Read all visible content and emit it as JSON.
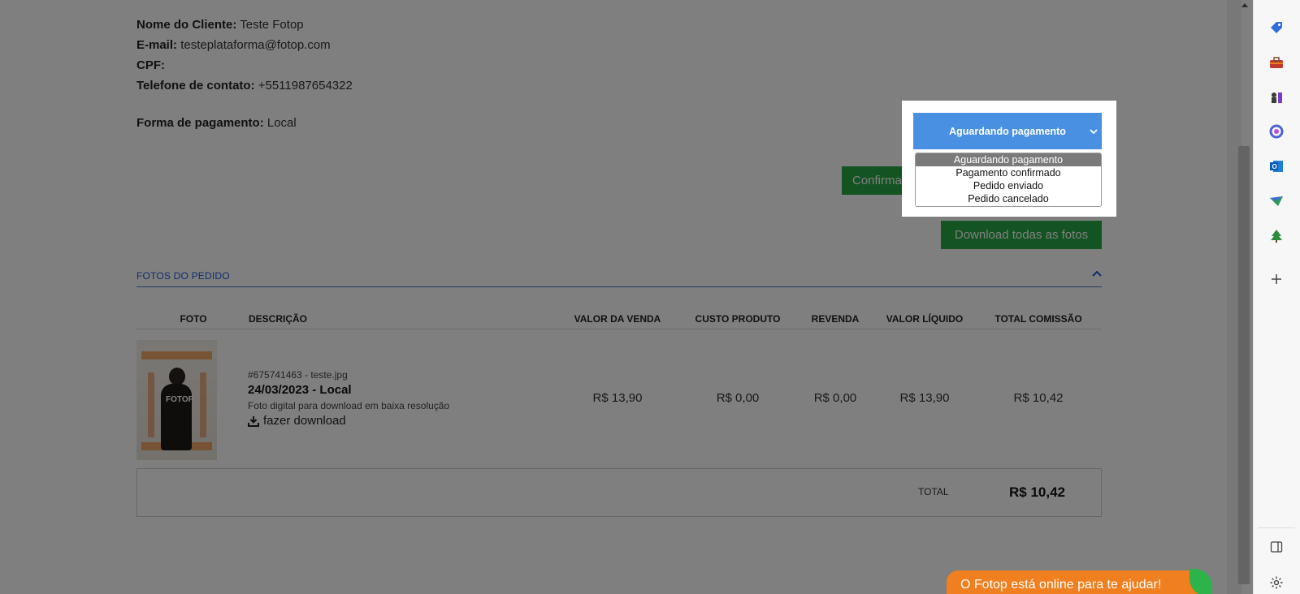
{
  "customer": {
    "name_label": "Nome do Cliente:",
    "name_value": "Teste Fotop",
    "email_label": "E-mail:",
    "email_value": "testeplataforma@fotop.com",
    "cpf_label": "CPF:",
    "cpf_value": "",
    "phone_label": "Telefone de contato:",
    "phone_value": "+5511987654322",
    "payment_label": "Forma de pagamento:",
    "payment_value": "Local"
  },
  "actions": {
    "confirm_label": "Confirmar p",
    "download_all_label": "Download todas as fotos"
  },
  "status_select": {
    "selected": "Aguardando pagamento",
    "options": [
      "Aguardando pagamento",
      "Pagamento confirmado",
      "Pedido enviado",
      "Pedido cancelado"
    ]
  },
  "photos_section": {
    "title": "FOTOS DO PEDIDO",
    "columns": [
      "FOTO",
      "DESCRIÇÃO",
      "VALOR DA VENDA",
      "CUSTO PRODUTO",
      "REVENDA",
      "VALOR LÍQUIDO",
      "TOTAL COMISSÃO"
    ],
    "rows": [
      {
        "photo_logo": "FOTOP",
        "id_file": "#675741463 - teste.jpg",
        "date_place": "24/03/2023 - Local",
        "description": "Foto digital para download em baixa resolução",
        "download_label": "fazer download",
        "sale_value": "R$ 13,90",
        "product_cost": "R$ 0,00",
        "resale": "R$ 0,00",
        "net_value": "R$ 13,90",
        "commission": "R$ 10,42"
      }
    ],
    "total_label": "TOTAL",
    "total_value": "R$ 10,42"
  },
  "chat": {
    "label": "O Fotop está online para te ajudar!"
  },
  "sidebar_icons": [
    "tag-icon",
    "toolbox-icon",
    "chess-icon",
    "copilot-icon",
    "outlook-icon",
    "send-icon",
    "tree-icon",
    "add-icon",
    "panel-icon",
    "settings-icon"
  ],
  "colors": {
    "accent_blue": "#4a90e2",
    "green": "#28a745",
    "chat_orange": "#f07f1f"
  }
}
